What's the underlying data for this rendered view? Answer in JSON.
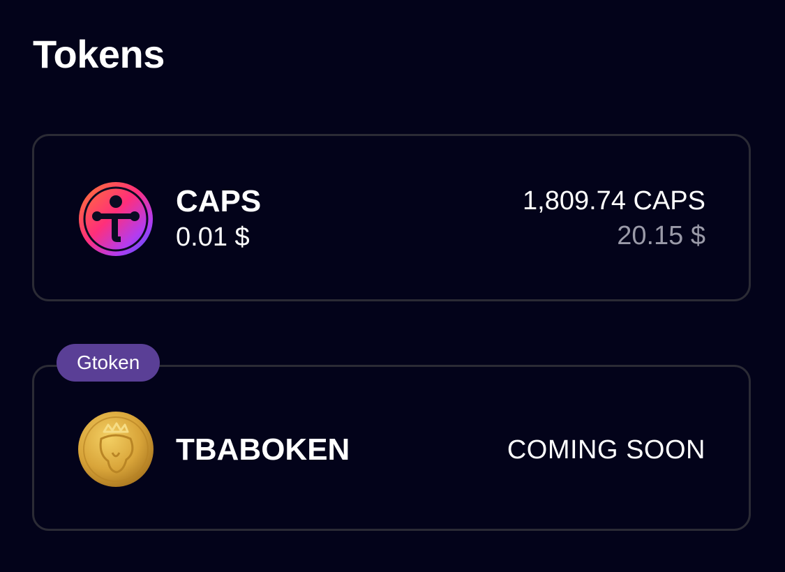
{
  "header": {
    "title": "Tokens"
  },
  "tokens": [
    {
      "icon": "caps-token-icon",
      "name": "CAPS",
      "price": "0.01 $",
      "balance": "1,809.74 CAPS",
      "balance_usd": "20.15 $"
    },
    {
      "icon": "tbaboken-token-icon",
      "badge": "Gtoken",
      "name": "TBABOKEN",
      "status": "COMING SOON"
    }
  ],
  "colors": {
    "background": "#03031a",
    "card_border": "#2b2b35",
    "badge_bg": "#5a3f96",
    "muted_text": "#9a9aa8"
  }
}
